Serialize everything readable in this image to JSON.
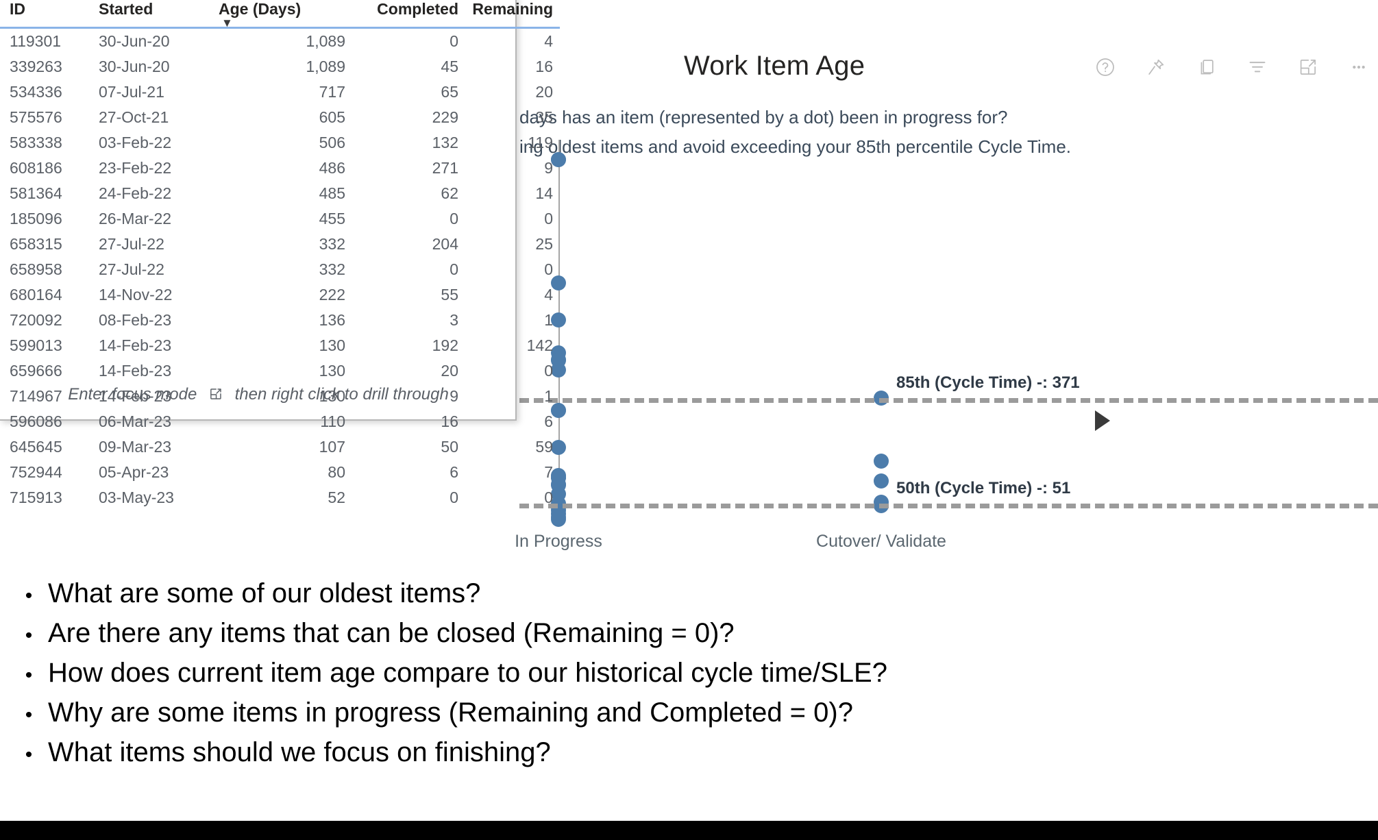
{
  "chart": {
    "title": "Work Item Age",
    "subtitle_lines": [
      "days has an item (represented by a dot) been in progress for?",
      "ing oldest items and avoid exceeding your 85th percentile Cycle Time."
    ],
    "header_icons": [
      {
        "name": "help-icon",
        "label": "Help"
      },
      {
        "name": "pin-icon",
        "label": "Pin to report"
      },
      {
        "name": "copy-icon",
        "label": "Copy visual"
      },
      {
        "name": "filter-icon",
        "label": "Filters"
      },
      {
        "name": "focus-mode-icon",
        "label": "Focus mode"
      },
      {
        "name": "more-options-icon",
        "label": "More options"
      }
    ],
    "accent_color": "#4c7cab",
    "reference_line_color": "#9b9b9b",
    "reference_label_color": "#2f3a46"
  },
  "chart_data": {
    "type": "scatter",
    "title": "Work Item Age",
    "xlabel": "",
    "ylabel": "Age (Days)",
    "grid": false,
    "ylim": [
      0,
      1150
    ],
    "categories": [
      "In Progress",
      "Cutover/ Validate"
    ],
    "reference_lines": [
      {
        "label": "85th (Cycle Time) -: 371",
        "value": 371,
        "style": "dashed"
      },
      {
        "label": "50th (Cycle Time) -: 51",
        "value": 51,
        "style": "dashed"
      }
    ],
    "series": [
      {
        "name": "In Progress",
        "category": "In Progress",
        "points": [
          1089,
          1089,
          717,
          605,
          506,
          486,
          485,
          455,
          332,
          332,
          222,
          136,
          130,
          130,
          130,
          110,
          107,
          80,
          52,
          40,
          30,
          20,
          10,
          5
        ]
      },
      {
        "name": "Cutover/ Validate",
        "category": "Cutover/ Validate",
        "points": [
          371,
          180,
          120,
          55,
          45
        ]
      }
    ]
  },
  "table": {
    "columns": [
      "ID",
      "Started",
      "Age (Days)",
      "Completed",
      "Remaining"
    ],
    "sorted_column": "Age (Days)",
    "sort_direction": "descending",
    "sort_caret": "▼",
    "footer_prefix": "Enter focus mode",
    "footer_suffix": "then right click to drill through",
    "rows": [
      {
        "id": "119301",
        "started": "30-Jun-20",
        "age": "1,089",
        "completed": "0",
        "remaining": "4"
      },
      {
        "id": "339263",
        "started": "30-Jun-20",
        "age": "1,089",
        "completed": "45",
        "remaining": "16"
      },
      {
        "id": "534336",
        "started": "07-Jul-21",
        "age": "717",
        "completed": "65",
        "remaining": "20"
      },
      {
        "id": "575576",
        "started": "27-Oct-21",
        "age": "605",
        "completed": "229",
        "remaining": "35"
      },
      {
        "id": "583338",
        "started": "03-Feb-22",
        "age": "506",
        "completed": "132",
        "remaining": "119"
      },
      {
        "id": "608186",
        "started": "23-Feb-22",
        "age": "486",
        "completed": "271",
        "remaining": "9"
      },
      {
        "id": "581364",
        "started": "24-Feb-22",
        "age": "485",
        "completed": "62",
        "remaining": "14"
      },
      {
        "id": "185096",
        "started": "26-Mar-22",
        "age": "455",
        "completed": "0",
        "remaining": "0"
      },
      {
        "id": "658315",
        "started": "27-Jul-22",
        "age": "332",
        "completed": "204",
        "remaining": "25"
      },
      {
        "id": "658958",
        "started": "27-Jul-22",
        "age": "332",
        "completed": "0",
        "remaining": "0"
      },
      {
        "id": "680164",
        "started": "14-Nov-22",
        "age": "222",
        "completed": "55",
        "remaining": "4"
      },
      {
        "id": "720092",
        "started": "08-Feb-23",
        "age": "136",
        "completed": "3",
        "remaining": "1"
      },
      {
        "id": "599013",
        "started": "14-Feb-23",
        "age": "130",
        "completed": "192",
        "remaining": "142"
      },
      {
        "id": "659666",
        "started": "14-Feb-23",
        "age": "130",
        "completed": "20",
        "remaining": "0"
      },
      {
        "id": "714967",
        "started": "14-Feb-23",
        "age": "130",
        "completed": "9",
        "remaining": "1"
      },
      {
        "id": "596086",
        "started": "06-Mar-23",
        "age": "110",
        "completed": "16",
        "remaining": "6"
      },
      {
        "id": "645645",
        "started": "09-Mar-23",
        "age": "107",
        "completed": "50",
        "remaining": "59"
      },
      {
        "id": "752944",
        "started": "05-Apr-23",
        "age": "80",
        "completed": "6",
        "remaining": "7"
      },
      {
        "id": "715913",
        "started": "03-May-23",
        "age": "52",
        "completed": "0",
        "remaining": "0"
      }
    ]
  },
  "bullets": [
    {
      "marker": "•",
      "text": "What are some of our oldest items?"
    },
    {
      "marker": "•",
      "text": "Are there any items that can be closed (Remaining = 0)?"
    },
    {
      "marker": "•",
      "text": "How does current item age compare to our historical cycle time/SLE?"
    },
    {
      "marker": "•",
      "text": "Why are some items in progress (Remaining and Completed = 0)?"
    },
    {
      "marker": "•",
      "text": "What items should we focus on finishing?"
    }
  ]
}
